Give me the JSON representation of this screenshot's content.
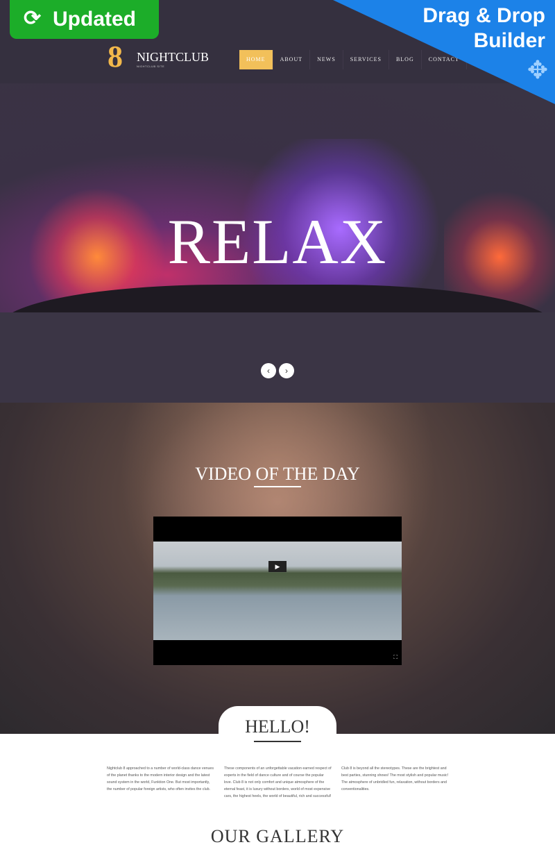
{
  "promo": {
    "updated": "Updated",
    "drag_line1": "Drag & Drop",
    "drag_line2": "Builder",
    "updated_color": "#1cad29",
    "builder_color": "#1c82e8"
  },
  "header": {
    "logo_glyph": "8",
    "brand": "NIGHTCLUB",
    "tagline": "NIGHTCLUB SITE",
    "nav": [
      {
        "label": "HOME",
        "active": true
      },
      {
        "label": "ABOUT"
      },
      {
        "label": "NEWS"
      },
      {
        "label": "SERVICES"
      },
      {
        "label": "BLOG"
      },
      {
        "label": "CONTACT"
      }
    ],
    "accent": "#f2c05a"
  },
  "hero": {
    "title": "RELAX",
    "prev": "‹",
    "next": "›"
  },
  "video": {
    "title": "VIDEO OF THE DAY",
    "play": "▶",
    "fullscreen": "⛶"
  },
  "hello": {
    "title": "HELLO!",
    "columns": [
      "Nightclub 8 approached to a number of world-class dance venues of the planet thanks to the modern interior design and the latest sound system in the world, Funktion One. But most importantly, the number of popular foreign artists, who often invites the club.",
      "These components of an unforgettable vacation earned respect of experts in the field of dance culture and of course the popular love. Club 8 is not only comfort and unique atmosphere of the eternal feast, it is luxury without borders, world of most expensive cars, the highest heels, the world of beautiful, rich and successful!",
      "Club 8 is beyond all the stereotypes. These are the brightest and best parties, stunning shows! The most stylish and popular music! The atmosphere of unbridled fun, relaxation, without borders and conventionalities."
    ]
  },
  "gallery": {
    "title": "OUR GALLERY"
  }
}
